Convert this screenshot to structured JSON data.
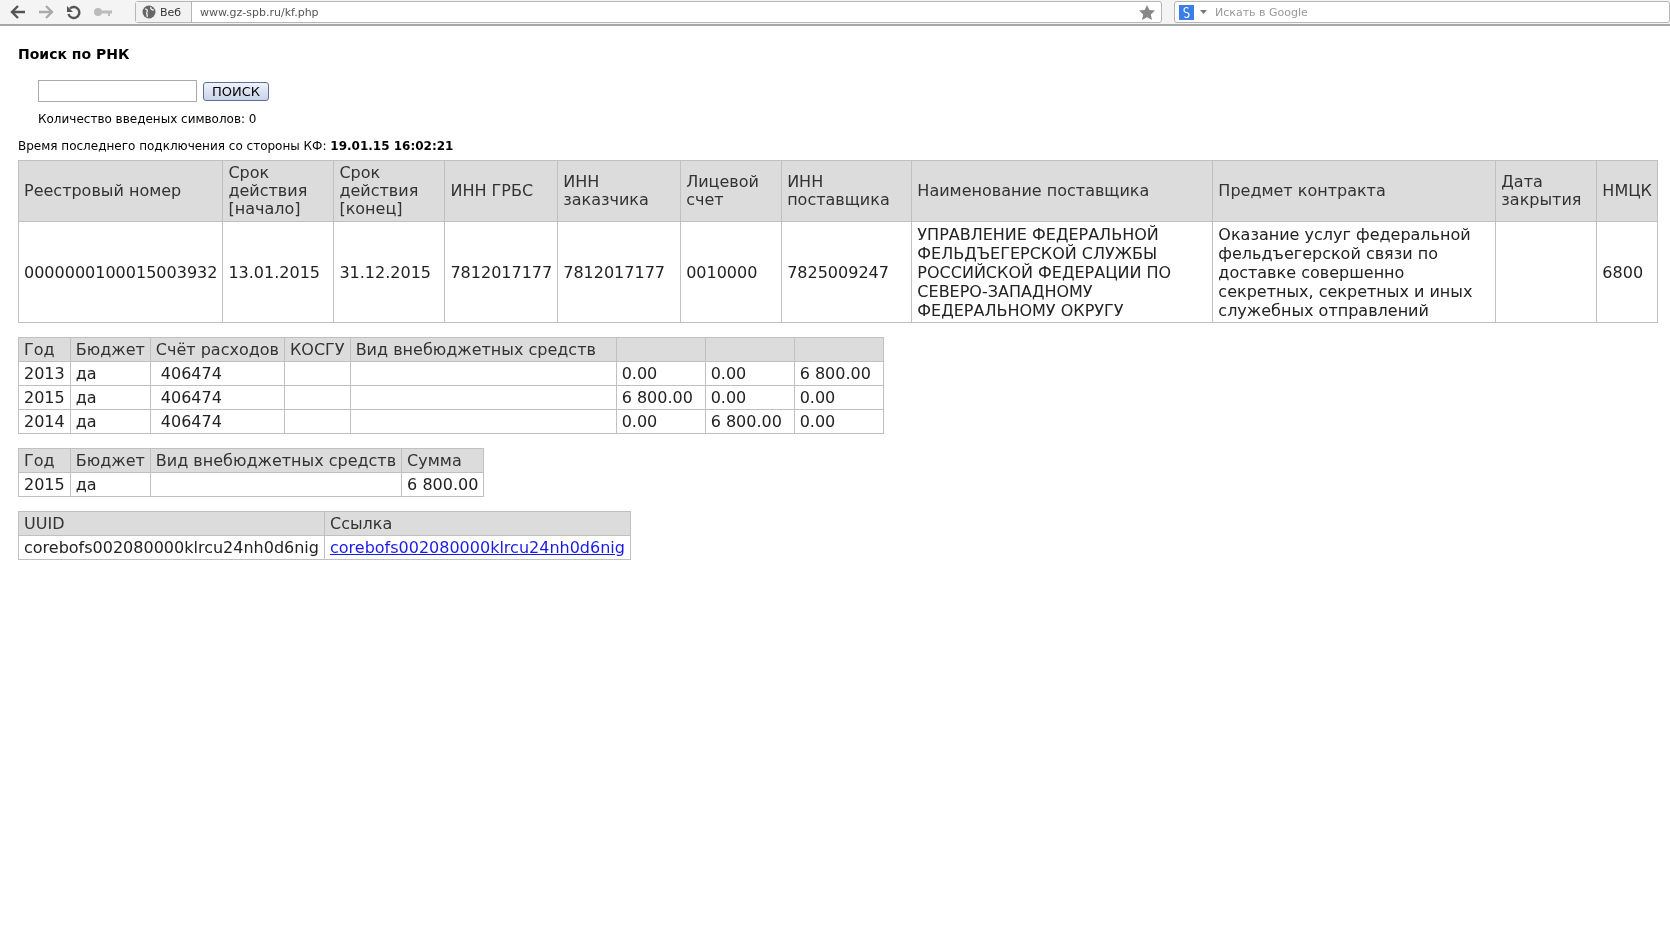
{
  "browser": {
    "scope_button": "Веб",
    "url": "www.gz-spb.ru/kf.php",
    "search_placeholder": "Искать в Google"
  },
  "search": {
    "title": "Поиск по РНК",
    "button": "ПОИСК",
    "counter": "Количество введеных символов: 0"
  },
  "last_connection": {
    "label": "Время последнего подключения со стороны КФ:",
    "value": "19.01.15 16:02:21"
  },
  "contract_table": {
    "columns": [
      "Реестровый номер",
      "Срок действия [начало]",
      "Срок действия [конец]",
      "ИНН ГРБС",
      "ИНН заказчика",
      "Лицевой счет",
      "ИНН поставщика",
      "Наименование поставщика",
      "Предмет контракта",
      "Дата закрытия",
      "НМЦК"
    ],
    "rows": [
      [
        "0000000100015003932",
        "13.01.2015",
        "31.12.2015",
        "7812017177",
        "7812017177",
        "0010000",
        "7825009247",
        "УПРАВЛЕНИЕ ФЕДЕРАЛЬНОЙ ФЕЛЬДЪЕГЕРСКОЙ СЛУЖБЫ РОССИЙСКОЙ ФЕДЕРАЦИИ ПО СЕВЕРО-ЗАПАДНОМУ ФЕДЕРАЛЬНОМУ ОКРУГУ",
        "Оказание услуг федеральной фельдъегерской связи по доставке совершенно секретных, секретных и иных служебных отправлений",
        null,
        "6800"
      ]
    ]
  },
  "finance_table": {
    "columns": [
      "Год",
      "Бюджет",
      "Счёт расходов",
      "КОСГУ",
      "Вид внебюджетных средств",
      null,
      null,
      null
    ],
    "rows": [
      [
        "2013",
        "да",
        "406474",
        null,
        null,
        "0.00",
        "0.00",
        "6 800.00"
      ],
      [
        "2015",
        "да",
        "406474",
        null,
        null,
        "6 800.00",
        "0.00",
        "0.00"
      ],
      [
        "2014",
        "да",
        "406474",
        null,
        null,
        "0.00",
        "6 800.00",
        "0.00"
      ]
    ]
  },
  "sum_table": {
    "columns": [
      "Год",
      "Бюджет",
      "Вид внебюджетных средств",
      "Сумма"
    ],
    "rows": [
      [
        "2015",
        "да",
        null,
        "6 800.00"
      ]
    ]
  },
  "uuid_table": {
    "columns": [
      "UUID",
      "Ссылка"
    ],
    "rows": [
      {
        "uuid": "corebofs002080000klrcu24nh0d6nig",
        "link": "corebofs002080000klrcu24nh0d6nig"
      }
    ]
  }
}
